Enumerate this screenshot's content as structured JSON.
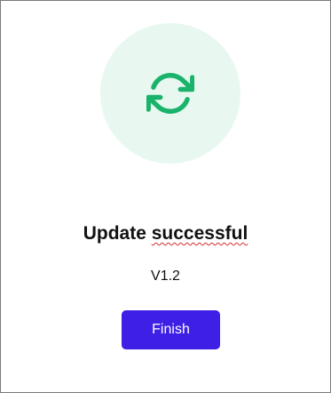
{
  "dialog": {
    "icon": "refresh-icon",
    "icon_color": "#19b36b",
    "circle_color": "#e8f8f0",
    "title_part1": "Update ",
    "title_part2": "successful",
    "version": "V1.2",
    "finish_label": "Finish",
    "button_color": "#3d1fe6"
  }
}
